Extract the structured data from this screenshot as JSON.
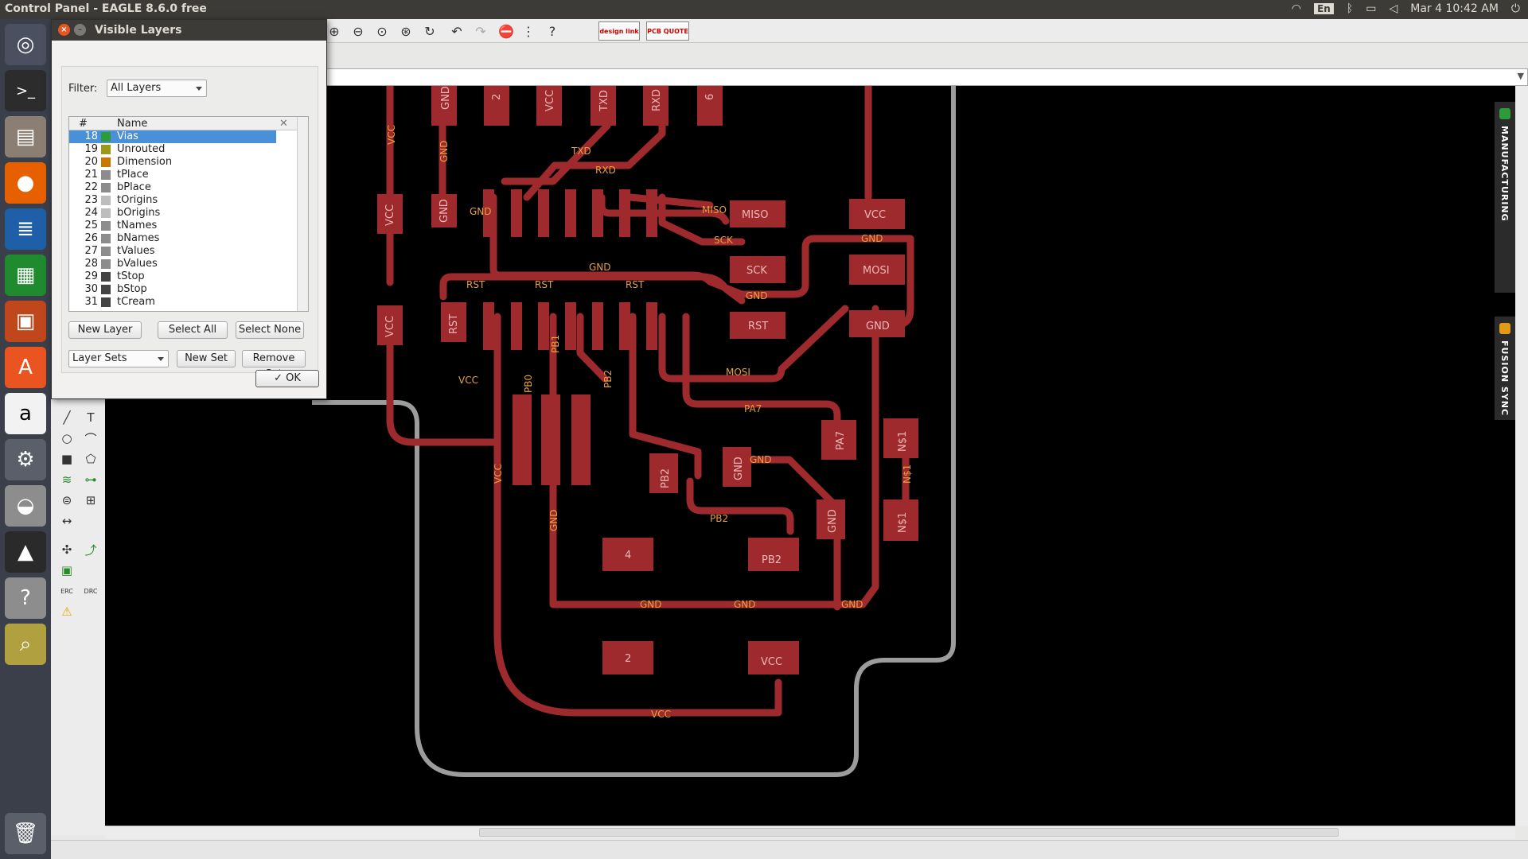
{
  "topbar": {
    "title": "Control Panel - EAGLE 8.6.0 free",
    "lang": "En",
    "clock": "Mar  4 10:42 AM"
  },
  "toolbar": {
    "design_link": "design link",
    "pcb_quote": "PCB QUOTE"
  },
  "side_tabs": {
    "manufacturing": "MANUFACTURING",
    "fusion_sync": "FUSION SYNC"
  },
  "palette": {
    "text_tool": "T",
    "erc": "ERC",
    "drc": "DRC"
  },
  "dialog": {
    "title": "Visible Layers",
    "filter_label": "Filter:",
    "filter_value": "All Layers",
    "columns": {
      "num": "#",
      "name": "Name"
    },
    "layers": [
      {
        "num": "18",
        "name": "Vias",
        "color": "#2e9b3a",
        "selected": true
      },
      {
        "num": "19",
        "name": "Unrouted",
        "color": "#9a9a18"
      },
      {
        "num": "20",
        "name": "Dimension",
        "color": "#c87800"
      },
      {
        "num": "21",
        "name": "tPlace",
        "color": "#8c8c8c"
      },
      {
        "num": "22",
        "name": "bPlace",
        "color": "#8c8c8c"
      },
      {
        "num": "23",
        "name": "tOrigins",
        "color": "#bdbdbd"
      },
      {
        "num": "24",
        "name": "bOrigins",
        "color": "#bdbdbd"
      },
      {
        "num": "25",
        "name": "tNames",
        "color": "#8c8c8c"
      },
      {
        "num": "26",
        "name": "bNames",
        "color": "#8c8c8c"
      },
      {
        "num": "27",
        "name": "tValues",
        "color": "#8c8c8c"
      },
      {
        "num": "28",
        "name": "bValues",
        "color": "#8c8c8c"
      },
      {
        "num": "29",
        "name": "tStop",
        "color": "#444444"
      },
      {
        "num": "30",
        "name": "bStop",
        "color": "#444444"
      },
      {
        "num": "31",
        "name": "tCream",
        "color": "#444444"
      }
    ],
    "buttons": {
      "new_layer": "New Layer",
      "select_all": "Select All",
      "select_none": "Select None",
      "layer_sets": "Layer Sets",
      "new_set": "New Set",
      "remove_set": "Remove Set",
      "ok": "OK"
    }
  },
  "board": {
    "pads": {
      "gnd_top": "GND",
      "p2_top": "2",
      "vcc_top": "VCC",
      "txd_top": "TXD",
      "rxd_top": "RXD",
      "p6_top": "6",
      "miso": "MISO",
      "vcc_r": "VCC",
      "sck": "SCK",
      "mosi": "MOSI",
      "rst": "RST",
      "gnd_r": "GND",
      "vcc_l1": "VCC",
      "vcc_l2": "VCC",
      "gnd_l": "GND",
      "rst_l": "RST",
      "pa7": "PA7",
      "n1a": "N$1",
      "n1b": "N$1",
      "pb2a": "PB2",
      "gnd_m": "GND",
      "gnd_m2": "GND",
      "p4": "4",
      "pb2b": "PB2",
      "p2_bot": "2",
      "vcc_bot": "VCC"
    },
    "signals": {
      "gnd": "GND",
      "vcc": "VCC",
      "txd": "TXD",
      "rxd": "RXD",
      "miso": "MISO",
      "sck": "SCK",
      "rst": "RST",
      "mosi": "MOSI",
      "pa7": "PA7",
      "pb2": "PB2",
      "pb1": "PB1",
      "pb0": "PB0",
      "n1": "N$1"
    }
  }
}
